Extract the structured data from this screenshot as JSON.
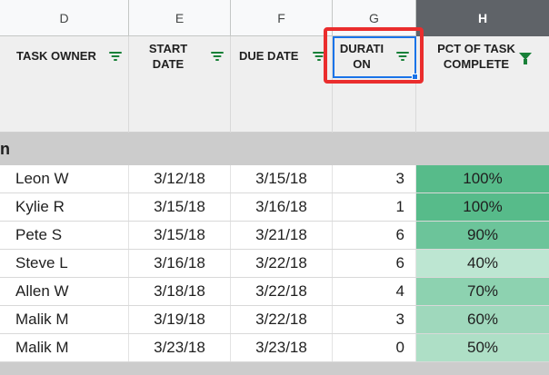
{
  "columns": [
    "D",
    "E",
    "F",
    "G",
    "H"
  ],
  "headers": {
    "task_owner": "TASK OWNER",
    "start_date_1": "START",
    "start_date_2": "DATE",
    "due_date": "DUE DATE",
    "duration_1": "DURATI",
    "duration_2": "ON",
    "pct_1": "PCT OF TASK",
    "pct_2": "COMPLETE"
  },
  "group_label": "n",
  "rows": [
    {
      "owner": "Leon W",
      "start": "3/12/18",
      "due": "3/15/18",
      "duration": "3",
      "pct": "100%",
      "pct_color": "#57bb8a"
    },
    {
      "owner": "Kylie R",
      "start": "3/15/18",
      "due": "3/16/18",
      "duration": "1",
      "pct": "100%",
      "pct_color": "#57bb8a"
    },
    {
      "owner": "Pete S",
      "start": "3/15/18",
      "due": "3/21/18",
      "duration": "6",
      "pct": "90%",
      "pct_color": "#6cc49a"
    },
    {
      "owner": "Steve L",
      "start": "3/16/18",
      "due": "3/22/18",
      "duration": "6",
      "pct": "40%",
      "pct_color": "#bde6d2"
    },
    {
      "owner": "Allen W",
      "start": "3/18/18",
      "due": "3/22/18",
      "duration": "4",
      "pct": "70%",
      "pct_color": "#8dd2b0"
    },
    {
      "owner": "Malik M",
      "start": "3/19/18",
      "due": "3/22/18",
      "duration": "3",
      "pct": "60%",
      "pct_color": "#9fd8bc"
    },
    {
      "owner": "Malik M",
      "start": "3/23/18",
      "due": "3/23/18",
      "duration": "0",
      "pct": "50%",
      "pct_color": "#aedfc6"
    }
  ]
}
